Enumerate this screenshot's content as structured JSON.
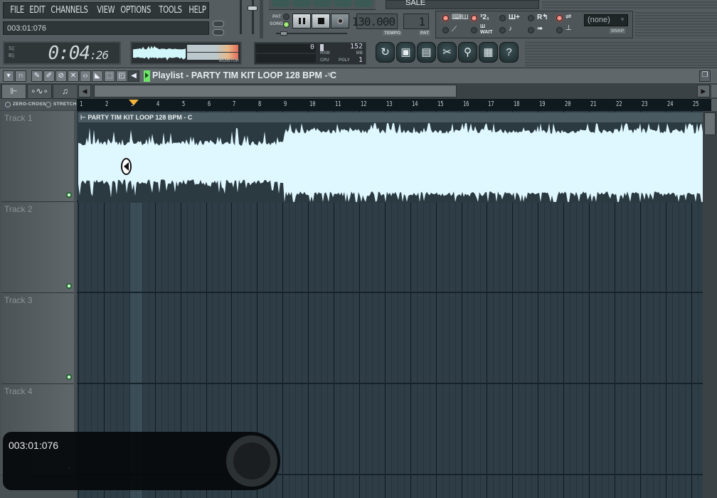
{
  "menu": {
    "items": [
      "FILE",
      "EDIT",
      "CHANNELS",
      "VIEW",
      "OPTIONS",
      "TOOLS",
      "HELP"
    ]
  },
  "hint_bar": {
    "text": "003:01:076"
  },
  "song_time": {
    "main": "0:04",
    "sub": ":26"
  },
  "monitor": {
    "label": "MONITOR"
  },
  "transport": {
    "pat_label": "PAT",
    "song_label": "SONG",
    "mode": "song"
  },
  "tempo": {
    "value": "130.000",
    "label": "TEMPO"
  },
  "pattern": {
    "value": "1",
    "label": "PAT"
  },
  "preset_bar": {
    "label": "SALE"
  },
  "cpu_panel": {
    "value": "0",
    "ram_value": "152",
    "ram_label": "RAM",
    "mb_label": "MB",
    "cpu_label": "CPU",
    "poly_label": "POLY",
    "poly_value": "1"
  },
  "snap": {
    "value": "(none)",
    "label": "SNAP"
  },
  "toggles_row1": [
    "typing-keyboard",
    "countdown-321",
    "step-edit",
    "recording-loop",
    "blend-notes"
  ],
  "toggles_row2": [
    "metronome",
    "wait-for-input",
    "tap-tempo",
    "scroll-follow",
    "multilink"
  ],
  "shortcut_buttons": [
    "undo",
    "save-new-version",
    "export-wave",
    "edison",
    "record-mic",
    "project-info",
    "help"
  ],
  "playlist": {
    "title": "Playlist - PARTY TIM KIT LOOP 128 BPM - C",
    "tabs": [
      "pattern-clips",
      "automation",
      "audio-clips"
    ],
    "zero_cross": "ZERO-CROSS",
    "stretch": "STRETCH",
    "ruler": [
      "1",
      "2",
      "3",
      "4",
      "5",
      "6",
      "7",
      "8",
      "9",
      "10",
      "11",
      "12",
      "13",
      "14",
      "15",
      "16",
      "17",
      "18",
      "19",
      "20",
      "21",
      "22",
      "23",
      "24",
      "25"
    ],
    "playhead_bar": 3,
    "tracks": [
      {
        "name": "Track 1"
      },
      {
        "name": "Track 2"
      },
      {
        "name": "Track 3"
      },
      {
        "name": "Track 4"
      }
    ],
    "clip": {
      "title": "PARTY TIM KIT LOOP 128 BPM - C",
      "track": 1
    }
  },
  "osd": {
    "text": "003:01:076"
  },
  "colors": {
    "waveform": "#dff7ff",
    "grid": "#2e3d46",
    "led_red": "#e05548",
    "led_green": "#5cc63a",
    "playhead": "#f3b43a"
  }
}
